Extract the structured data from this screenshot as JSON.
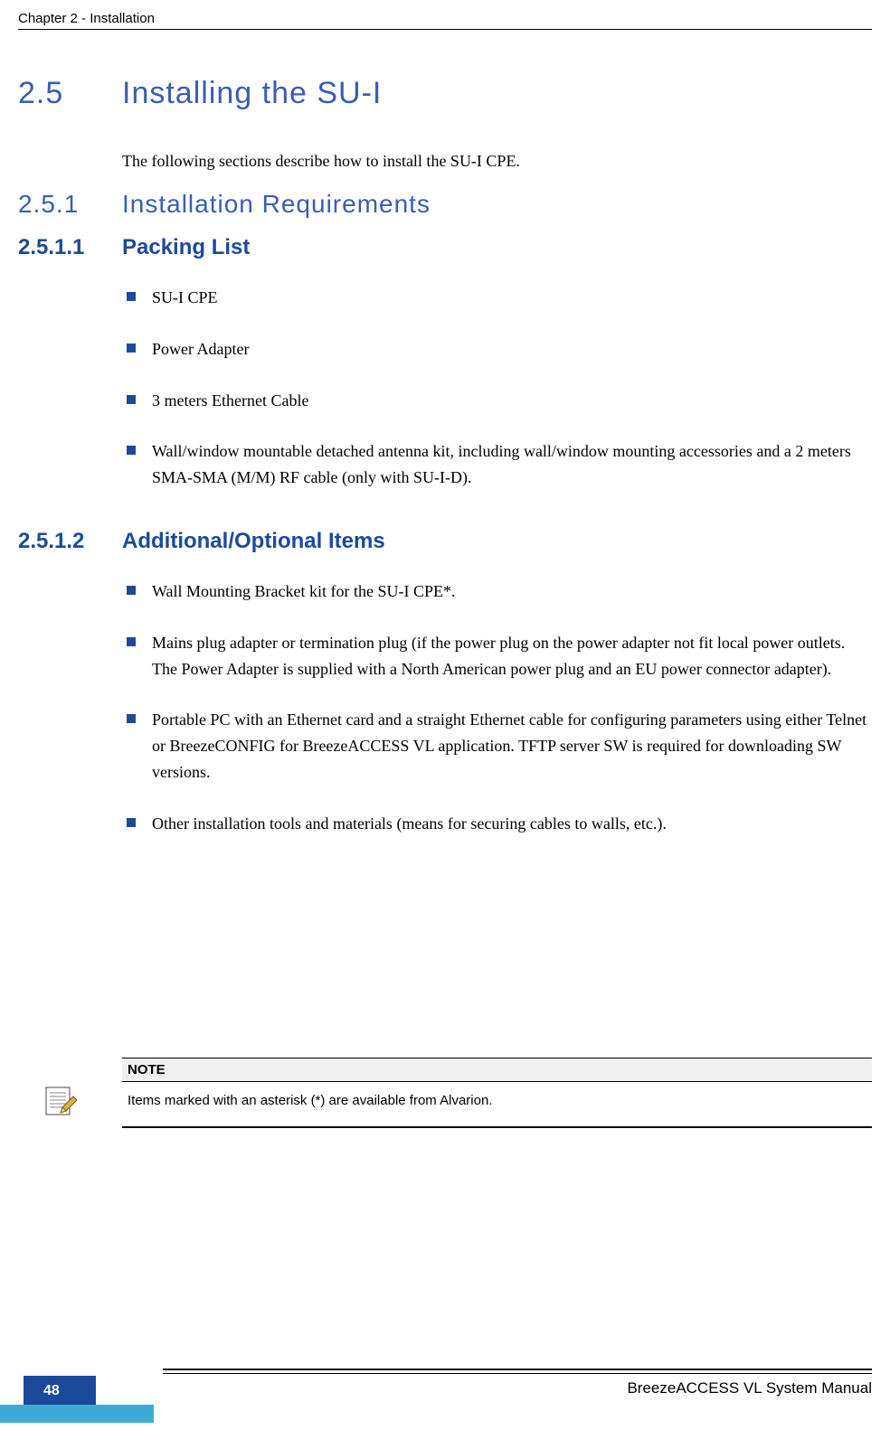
{
  "header": {
    "chapter": "Chapter 2 - Installation"
  },
  "section25": {
    "num": "2.5",
    "title": "Installing the SU-I"
  },
  "intro": "The following sections describe how to install the SU-I CPE.",
  "section251": {
    "num": "2.5.1",
    "title": "Installation Requirements"
  },
  "section2511": {
    "num": "2.5.1.1",
    "title": "Packing List"
  },
  "packing": {
    "i0": "SU-I CPE",
    "i1": "Power Adapter",
    "i2": "3 meters Ethernet Cable",
    "i3": "Wall/window mountable detached antenna kit, including wall/window mounting accessories and a 2 meters SMA-SMA (M/M) RF cable (only with SU-I-D)."
  },
  "section2512": {
    "num": "2.5.1.2",
    "title": "Additional/Optional Items"
  },
  "optional": {
    "i0": "Wall Mounting Bracket kit for the SU-I CPE*.",
    "i1": "Mains plug adapter or termination plug (if the power plug on the power adapter not fit local power outlets. The Power Adapter is supplied with a North American power plug and an EU power connector adapter).",
    "i2": "Portable PC with an Ethernet card and a straight Ethernet cable for configuring parameters using either Telnet or BreezeCONFIG for BreezeACCESS VL application. TFTP server SW is required for downloading SW versions.",
    "i3": "Other installation tools and materials (means for securing cables to walls, etc.)."
  },
  "note": {
    "label": "NOTE",
    "text": "Items marked with an asterisk (*) are available from Alvarion."
  },
  "footer": {
    "manual": "BreezeACCESS VL System Manual",
    "page": "48"
  }
}
